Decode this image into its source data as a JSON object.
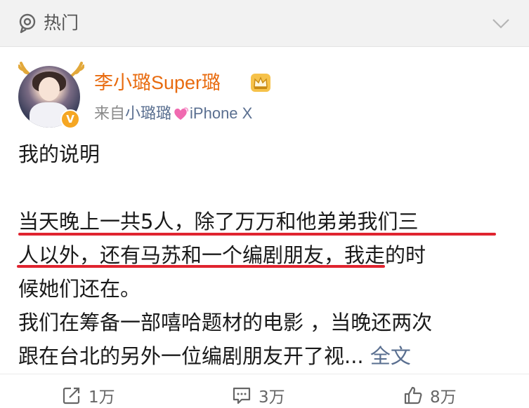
{
  "header": {
    "label": "热门",
    "location_icon": "location-pin-icon",
    "collapse_icon": "chevron-down-icon"
  },
  "post": {
    "user": {
      "name": "李小璐Super璐",
      "avatar_icon": "avatar",
      "verified_badge": "V",
      "crown_icon": "crown-icon"
    },
    "source": {
      "via": "来自",
      "client_prefix": "小璐璐",
      "heart_icon": "heart-icon",
      "client_device": "iPhone X"
    },
    "title": "我的说明",
    "lines": [
      "当天晚上一共5人，除了万万和他弟弟我们三",
      "人以外，还有马苏和一个编剧朋友，我走的时",
      "候她们还在。",
      "我们在筹备一部嘻哈题材的电影 ，当晚还两次",
      "跟在台北的另外一位编剧朋友开了视..."
    ],
    "full_text_link": "全文"
  },
  "actions": {
    "repost": "1万",
    "comment": "3万",
    "like": "8万"
  },
  "colors": {
    "username": "#e86b0f",
    "link": "#5a6f90",
    "underline": "#e0242f",
    "header_bg": "#f2f2f2"
  }
}
